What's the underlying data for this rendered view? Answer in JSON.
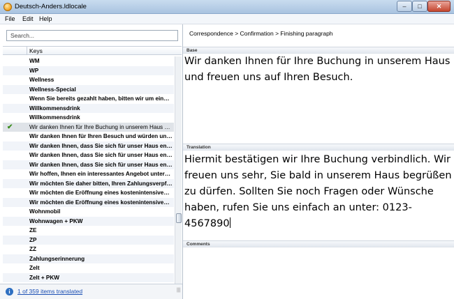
{
  "window": {
    "title": "Deutsch-Anders.ldlocale"
  },
  "menu": [
    "File",
    "Edit",
    "Help"
  ],
  "search": {
    "placeholder": "Search..."
  },
  "list": {
    "column_header": "Keys",
    "rows": [
      {
        "text": "WM",
        "status": ""
      },
      {
        "text": "WP",
        "status": ""
      },
      {
        "text": "Wellness",
        "status": ""
      },
      {
        "text": "Wellness-Special",
        "status": ""
      },
      {
        "text": "Wenn Sie bereits gezahlt haben, bitten wir um eine …",
        "status": ""
      },
      {
        "text": "Willkommensdrink",
        "status": ""
      },
      {
        "text": "Willkommensdrink",
        "status": ""
      },
      {
        "text": "Wir danken Ihnen für Ihre Buchung in unserem Haus un…",
        "status": "translated"
      },
      {
        "text": "Wir danken Ihnen für Ihren Besuch und würden uns …",
        "status": ""
      },
      {
        "text": "Wir danken Ihnen, dass Sie sich für unser Haus ents…",
        "status": ""
      },
      {
        "text": "Wir danken Ihnen, dass Sie sich für unser Haus ents…",
        "status": ""
      },
      {
        "text": "Wir danken Ihnen, dass Sie sich für unser Haus ents…",
        "status": ""
      },
      {
        "text": "Wir hoffen, Ihnen ein interessantes Angebot unterbr…",
        "status": ""
      },
      {
        "text": "Wir möchten Sie daher bitten, Ihren Zahlungsverpfli…",
        "status": ""
      },
      {
        "text": "Wir möchten die Eröffnung eines kostenintensiven I…",
        "status": ""
      },
      {
        "text": "Wir möchten die Eröffnung eines kostenintensiven I…",
        "status": ""
      },
      {
        "text": "Wohnmobil",
        "status": ""
      },
      {
        "text": "Wohnwagen + PKW",
        "status": ""
      },
      {
        "text": "ZE",
        "status": ""
      },
      {
        "text": "ZP",
        "status": ""
      },
      {
        "text": "ZZ",
        "status": ""
      },
      {
        "text": "Zahlungserinnerung",
        "status": ""
      },
      {
        "text": "Zelt",
        "status": ""
      },
      {
        "text": "Zelt + PKW",
        "status": ""
      }
    ],
    "scroll_position": 0.72
  },
  "status": {
    "text": "1 of 359 items translated"
  },
  "editor": {
    "breadcrumb": "Correspondence > Confirmation > Finishing paragraph",
    "base_label": "Base",
    "base_text": "Wir danken Ihnen für Ihre Buchung in unserem Haus und freuen uns auf Ihren Besuch.",
    "translation_label": "Translation",
    "translation_text": "Hiermit bestätigen wir Ihre Buchung verbindlich. Wir freuen uns sehr, Sie bald in unserem Haus begrüßen zu dürfen. Sollten Sie noch Fragen oder Wünsche haben, rufen Sie uns einfach an unter: 0123-4567890",
    "comments_label": "Comments"
  },
  "icons": {
    "check": "check-icon",
    "info": "info-icon",
    "app": "app-icon"
  },
  "colors": {
    "check": "#3a8c1d",
    "link": "#1b4fb4",
    "selected_row": "#dfe3e8"
  }
}
